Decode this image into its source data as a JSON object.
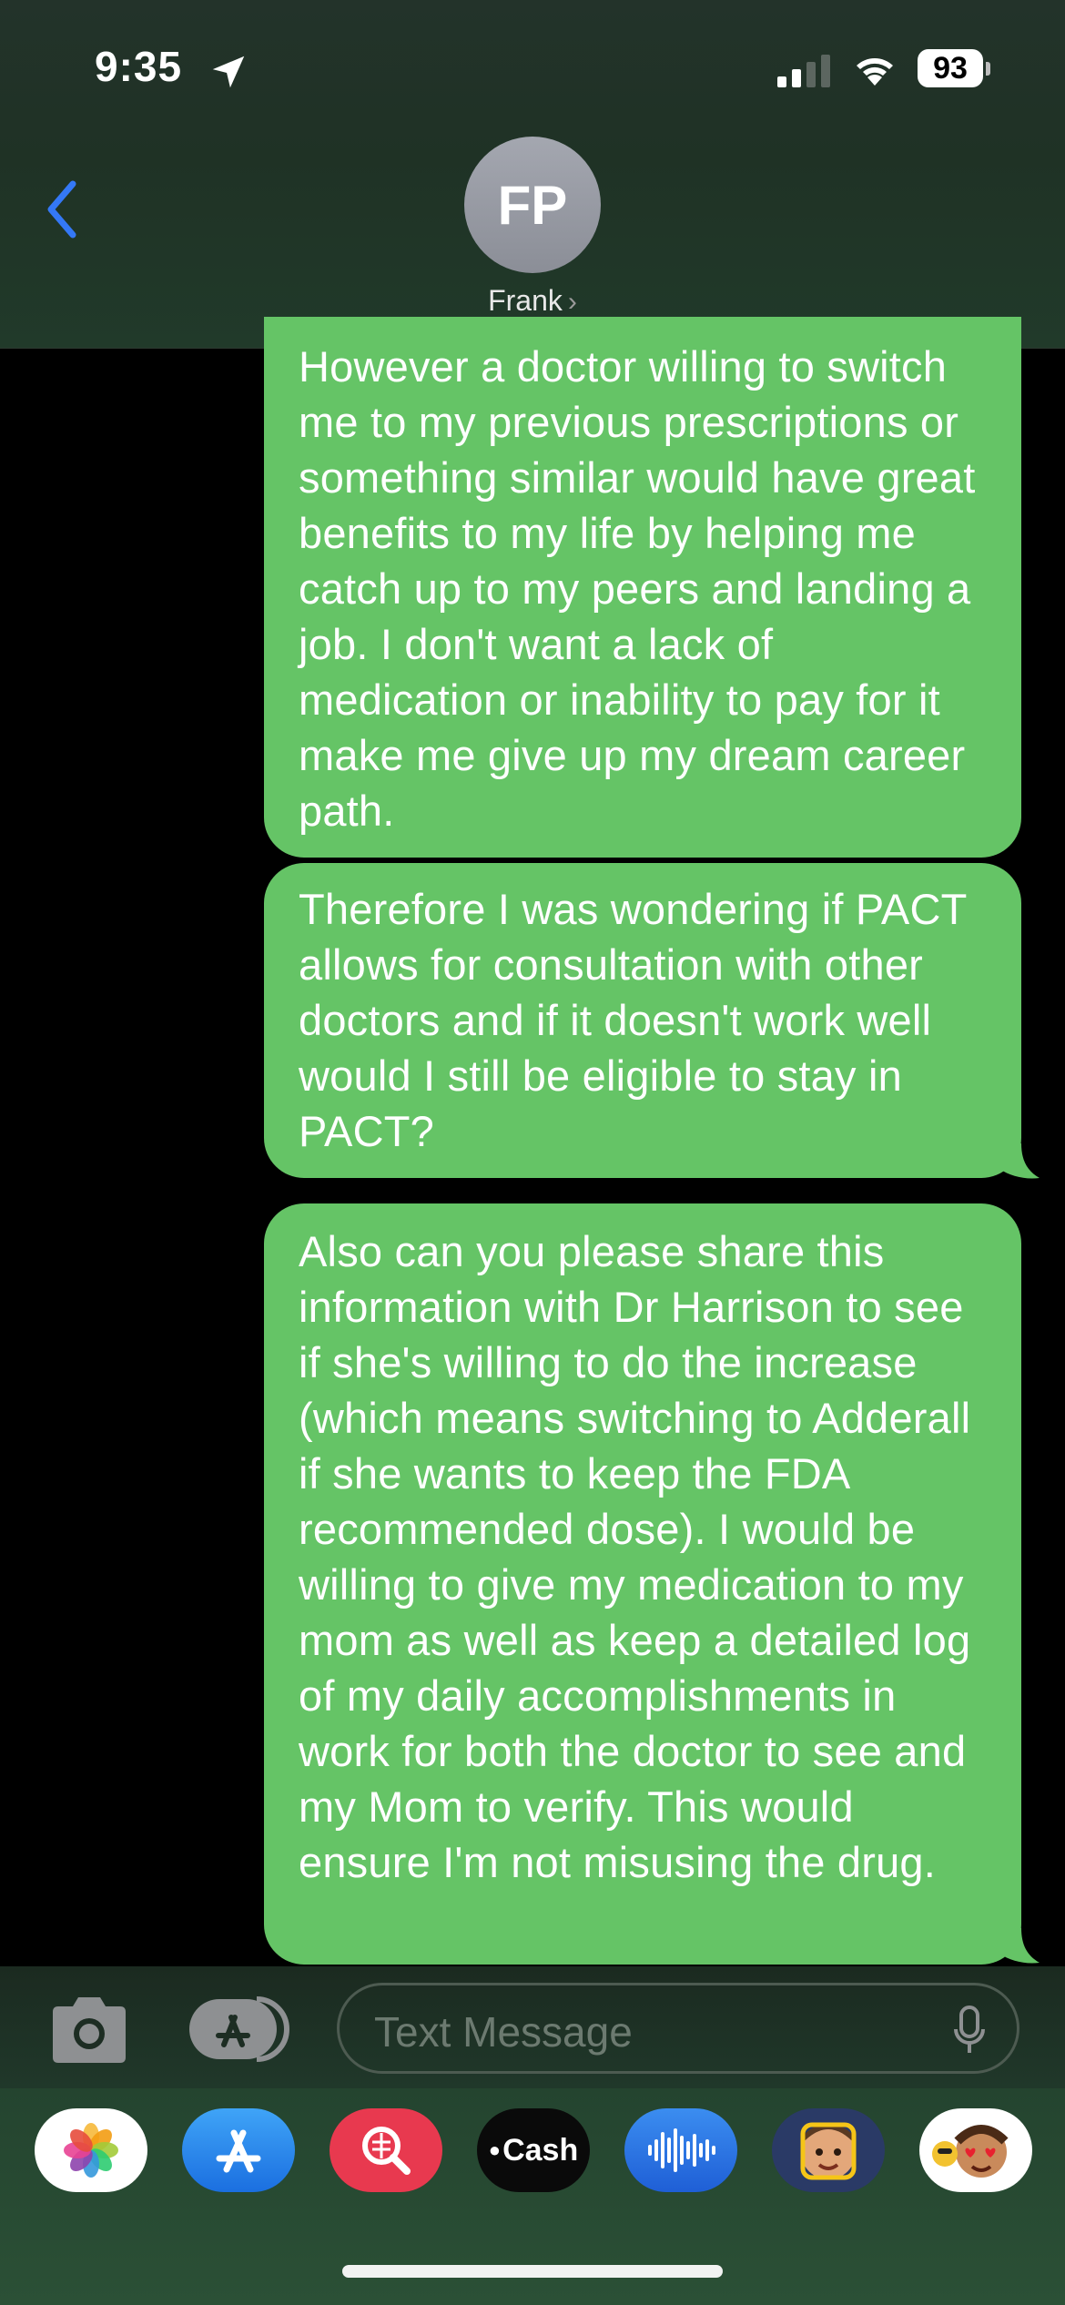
{
  "status_bar": {
    "time": "9:35",
    "battery": "93"
  },
  "header": {
    "avatar_initials": "FP",
    "contact_name": "Frank"
  },
  "messages": [
    {
      "direction": "outgoing",
      "text": "However a doctor willing to switch me to my previous prescriptions or something similar would have great benefits to my life by helping me catch up to my peers and landing a job. I don't want a lack of medication or inability to pay for it make me give up my dream career path."
    },
    {
      "direction": "outgoing",
      "text": "Therefore I was wondering if PACT allows for consultation with other doctors and if it doesn't work well would I still be eligible to stay in PACT?"
    },
    {
      "direction": "outgoing",
      "text": "Also can you please share this information with Dr Harrison to see if she's willing to do the increase (which means switching to Adderall if she wants to keep the FDA recommended dose). I would be willing to give my medication to my mom as well as keep a detailed log of my daily accomplishments in work for both the doctor to see and my Mom to verify. This would ensure I'm not misusing the drug."
    }
  ],
  "input": {
    "placeholder": "Text Message"
  },
  "app_drawer": [
    {
      "name": "photos-icon"
    },
    {
      "name": "app-store-icon"
    },
    {
      "name": "image-search-icon"
    },
    {
      "name": "apple-cash-icon",
      "label": "Cash"
    },
    {
      "name": "audio-message-icon"
    },
    {
      "name": "memoji-icon"
    },
    {
      "name": "animoji-stickers-icon"
    }
  ],
  "colors": {
    "bubble_green": "#65c466",
    "accent_blue": "#3478f6"
  }
}
